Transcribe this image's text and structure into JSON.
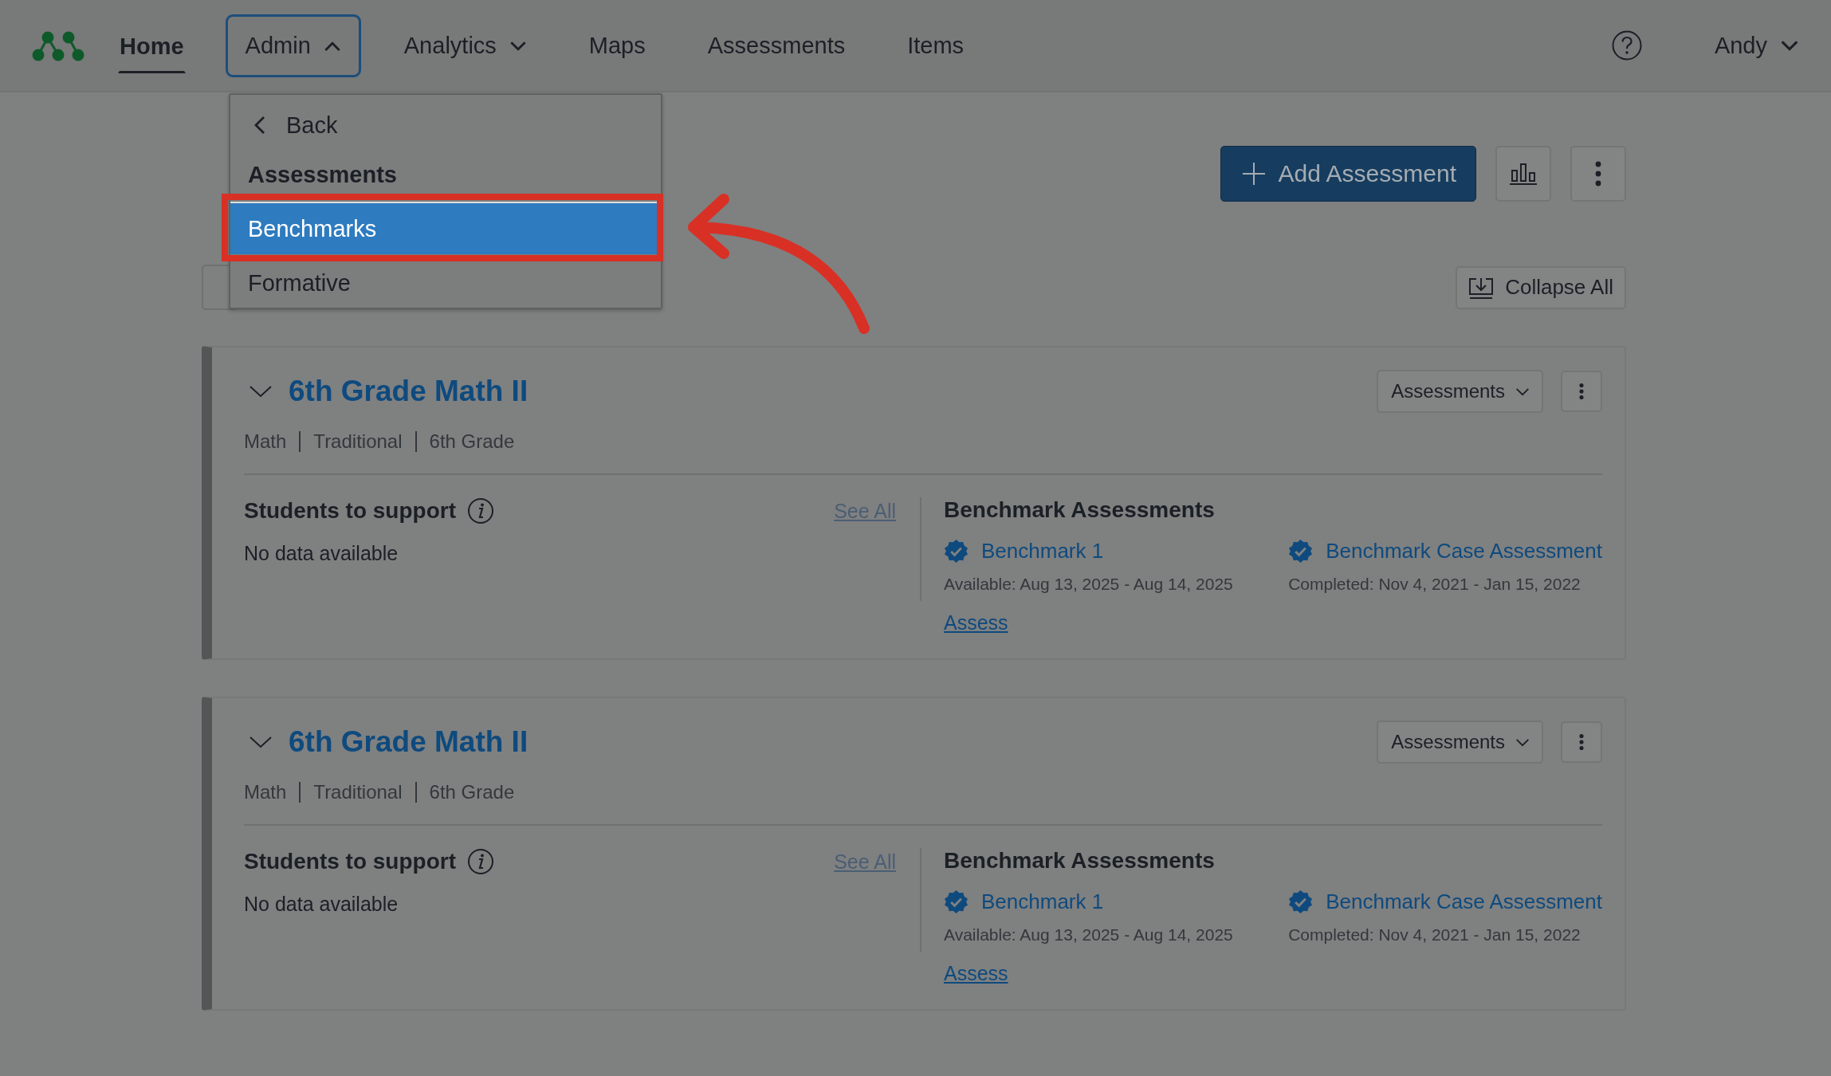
{
  "nav": {
    "items": [
      {
        "label": "Home",
        "kind": "link",
        "selected": true
      },
      {
        "label": "Admin",
        "kind": "menu",
        "selected": false,
        "expanded": true
      },
      {
        "label": "Analytics",
        "kind": "menu",
        "selected": false,
        "expanded": false
      },
      {
        "label": "Maps",
        "kind": "link",
        "selected": false
      },
      {
        "label": "Assessments",
        "kind": "link",
        "selected": false
      },
      {
        "label": "Items",
        "kind": "link",
        "selected": false
      }
    ],
    "user": "Andy"
  },
  "dropdown": {
    "back": "Back",
    "heading": "Assessments",
    "items": [
      {
        "label": "Benchmarks",
        "selected": true
      },
      {
        "label": "Formative",
        "selected": false
      }
    ]
  },
  "add_button": "Add Assessment",
  "collapse_button": "Collapse All",
  "courses": [
    {
      "title": "6th Grade Math II",
      "expanded": true,
      "meta": [
        "Math",
        "Traditional",
        "6th Grade"
      ],
      "menu_label": "Assessments",
      "support": {
        "heading": "Students to support",
        "see_all": "See All",
        "empty": "No data available"
      },
      "benchmarks": {
        "heading": "Benchmark Assessments",
        "items": [
          {
            "name": "Benchmark 1",
            "dates": "Available: Aug 13, 2025 - Aug 14, 2025",
            "action": "Assess"
          },
          {
            "name": "Benchmark Case Assessment",
            "dates": "Completed: Nov 4, 2021 - Jan 15, 2022"
          }
        ]
      }
    },
    {
      "title": "6th Grade Math II",
      "expanded": true,
      "meta": [
        "Math",
        "Traditional",
        "6th Grade"
      ],
      "menu_label": "Assessments",
      "support": {
        "heading": "Students to support",
        "see_all": "See All",
        "empty": "No data available"
      },
      "benchmarks": {
        "heading": "Benchmark Assessments",
        "items": [
          {
            "name": "Benchmark 1",
            "dates": "Available: Aug 13, 2025 - Aug 14, 2025",
            "action": "Assess"
          },
          {
            "name": "Benchmark Case Assessment",
            "dates": "Completed: Nov 4, 2021 - Jan 15, 2022"
          }
        ]
      }
    }
  ]
}
